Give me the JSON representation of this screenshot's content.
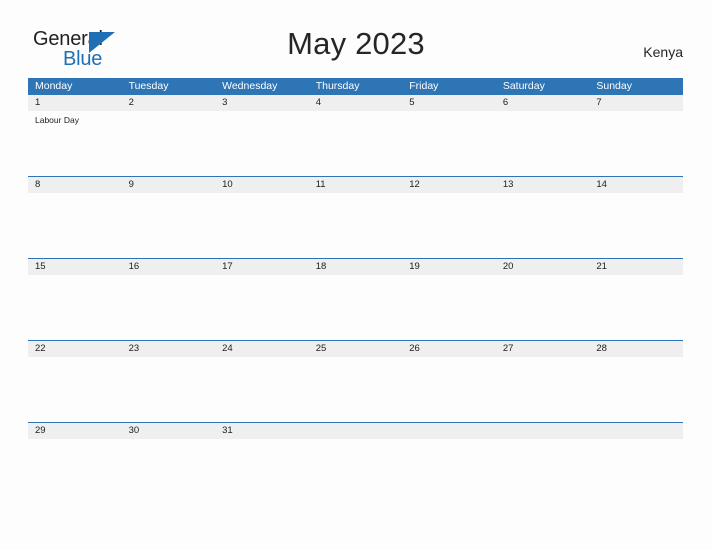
{
  "brand": {
    "name_part1": "General",
    "name_part2": "Blue",
    "triangle_icon": "blue-triangle-icon",
    "accent_color": "#1f6fb5"
  },
  "header": {
    "title": "May 2023",
    "country": "Kenya"
  },
  "theme": {
    "header_blue": "#2e75b6",
    "daynum_band": "#efefef",
    "page_background": "#fdfdfd",
    "text_color": "#202020"
  },
  "calendar": {
    "month": "May",
    "year": "2023",
    "weekday_headers": [
      "Monday",
      "Tuesday",
      "Wednesday",
      "Thursday",
      "Friday",
      "Saturday",
      "Sunday"
    ],
    "weeks": [
      {
        "days": [
          {
            "number": "1",
            "events": "Labour Day"
          },
          {
            "number": "2",
            "events": ""
          },
          {
            "number": "3",
            "events": ""
          },
          {
            "number": "4",
            "events": ""
          },
          {
            "number": "5",
            "events": ""
          },
          {
            "number": "6",
            "events": ""
          },
          {
            "number": "7",
            "events": ""
          }
        ]
      },
      {
        "days": [
          {
            "number": "8",
            "events": ""
          },
          {
            "number": "9",
            "events": ""
          },
          {
            "number": "10",
            "events": ""
          },
          {
            "number": "11",
            "events": ""
          },
          {
            "number": "12",
            "events": ""
          },
          {
            "number": "13",
            "events": ""
          },
          {
            "number": "14",
            "events": ""
          }
        ]
      },
      {
        "days": [
          {
            "number": "15",
            "events": ""
          },
          {
            "number": "16",
            "events": ""
          },
          {
            "number": "17",
            "events": ""
          },
          {
            "number": "18",
            "events": ""
          },
          {
            "number": "19",
            "events": ""
          },
          {
            "number": "20",
            "events": ""
          },
          {
            "number": "21",
            "events": ""
          }
        ]
      },
      {
        "days": [
          {
            "number": "22",
            "events": ""
          },
          {
            "number": "23",
            "events": ""
          },
          {
            "number": "24",
            "events": ""
          },
          {
            "number": "25",
            "events": ""
          },
          {
            "number": "26",
            "events": ""
          },
          {
            "number": "27",
            "events": ""
          },
          {
            "number": "28",
            "events": ""
          }
        ]
      },
      {
        "days": [
          {
            "number": "29",
            "events": ""
          },
          {
            "number": "30",
            "events": ""
          },
          {
            "number": "31",
            "events": ""
          },
          {
            "number": "",
            "events": ""
          },
          {
            "number": "",
            "events": ""
          },
          {
            "number": "",
            "events": ""
          },
          {
            "number": "",
            "events": ""
          }
        ]
      }
    ]
  }
}
